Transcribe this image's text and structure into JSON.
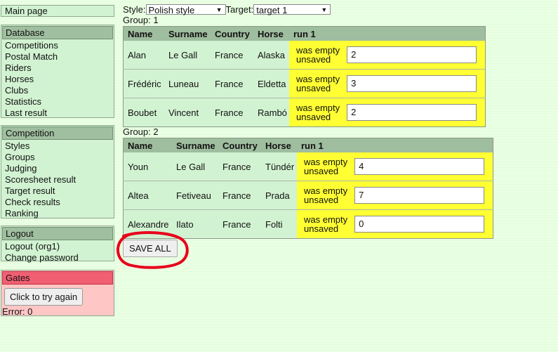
{
  "sidebar": {
    "main_page": "Main page",
    "database": {
      "title": "Database",
      "items": [
        "Competitions",
        "Postal Match",
        "Riders",
        "Horses",
        "Clubs",
        "Statistics",
        "Last result"
      ]
    },
    "competition": {
      "title": "Competition",
      "items": [
        "Styles",
        "Groups",
        "Judging",
        "Scoresheet result",
        "Target result",
        "Check results",
        "Ranking"
      ]
    },
    "account": {
      "title": "Logout",
      "items": [
        "Logout (org1)",
        "Change password"
      ]
    },
    "gates": {
      "title": "Gates",
      "button": "Click to try again",
      "error": "Error: 0",
      "color": "#f06072"
    }
  },
  "filters": {
    "style_label": "Style:",
    "style_value": "Polish style",
    "target_label": "Target:",
    "target_value": "target 1"
  },
  "columns": [
    "Name",
    "Surname",
    "Country",
    "Horse",
    "run 1"
  ],
  "groups": [
    {
      "label": "Group: 1",
      "rows": [
        {
          "name": "Alan",
          "surname": "Le Gall",
          "country": "France",
          "horse": "Alaska",
          "status1": "was empty",
          "status2": "unsaved",
          "value": "2"
        },
        {
          "name": "Frédéric",
          "surname": "Luneau",
          "country": "France",
          "horse": "Eldetta",
          "status1": "was empty",
          "status2": "unsaved",
          "value": "3"
        },
        {
          "name": "Boubet",
          "surname": "Vincent",
          "country": "France",
          "horse": "Rambó",
          "status1": "was empty",
          "status2": "unsaved",
          "value": "2"
        }
      ]
    },
    {
      "label": "Group: 2",
      "rows": [
        {
          "name": "Youn",
          "surname": "Le Gall",
          "country": "France",
          "horse": "Tündér",
          "status1": "was empty",
          "status2": "unsaved",
          "value": "4"
        },
        {
          "name": "Altea",
          "surname": "Fetiveau",
          "country": "France",
          "horse": "Prada",
          "status1": "was empty",
          "status2": "unsaved",
          "value": "7"
        },
        {
          "name": "Alexandre",
          "surname": "Ilato",
          "country": "France",
          "horse": "Folti",
          "status1": "was empty",
          "status2": "unsaved",
          "value": "0"
        }
      ]
    }
  ],
  "save_all": "SAVE ALL",
  "colors": {
    "background": "#e6ffdf",
    "unsaved_highlight": "#ffff33",
    "annotation": "#e8001b"
  }
}
